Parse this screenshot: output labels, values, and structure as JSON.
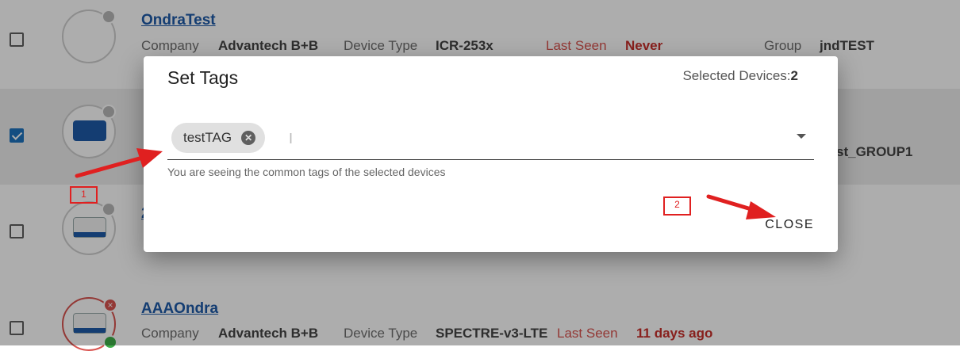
{
  "devices": [
    {
      "name": "OndraTest",
      "company_label": "Company",
      "company": "Advantech B+B",
      "type_label": "Device Type",
      "type": "ICR-253x",
      "seen_label": "Last Seen",
      "seen": "Never",
      "group_label": "Group",
      "group": "jndTEST"
    },
    {
      "group_suffix": "st_GROUP1"
    },
    {
      "name_fragment": "2"
    },
    {
      "name": "AAAOndra",
      "company_label": "Company",
      "company": "Advantech B+B",
      "type_label": "Device Type",
      "type": "SPECTRE-v3-LTE",
      "seen_label": "Last Seen",
      "seen": "11 days ago",
      "status_icon": "×"
    }
  ],
  "dialog": {
    "title": "Set Tags",
    "selected_label": "Selected Devices:",
    "selected_count": "2",
    "tags": [
      "testTAG"
    ],
    "helper": "You are seeing the common tags of the selected devices",
    "close_label": "CLOSE"
  },
  "annotations": {
    "marker1": "1",
    "marker2": "2"
  },
  "colors": {
    "link": "#1e5aa8",
    "accent_red": "#e02020",
    "checkbox": "#1e73be"
  }
}
